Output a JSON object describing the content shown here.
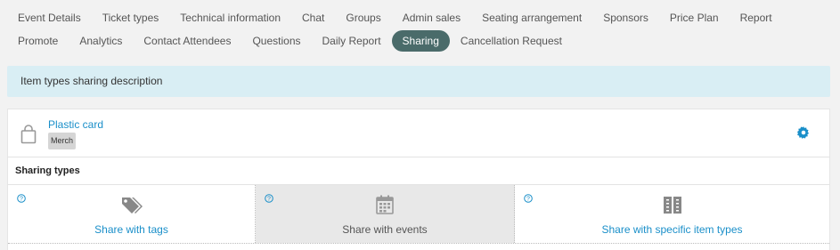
{
  "tabs_row1": [
    "Event Details",
    "Ticket types",
    "Technical information",
    "Chat",
    "Groups",
    "Admin sales",
    "Seating arrangement",
    "Sponsors",
    "Price Plan",
    "Report"
  ],
  "tabs_row2": [
    "Promote",
    "Analytics",
    "Contact Attendees",
    "Questions",
    "Daily Report",
    "Sharing",
    "Cancellation Request"
  ],
  "active_tab": "Sharing",
  "alert": {
    "text": "Item types sharing description"
  },
  "item": {
    "name": "Plastic card",
    "badge": "Merch"
  },
  "sharing": {
    "title": "Sharing types",
    "options": [
      {
        "label": "Share with tags",
        "icon": "tags-icon"
      },
      {
        "label": "Share with events",
        "icon": "calendar-icon"
      },
      {
        "label": "Share with specific item types",
        "icon": "tickets-icon"
      }
    ]
  },
  "colors": {
    "active_tab_bg": "#4a6b6a",
    "link": "#1a8fc9",
    "alert_bg": "#d9eef4"
  }
}
